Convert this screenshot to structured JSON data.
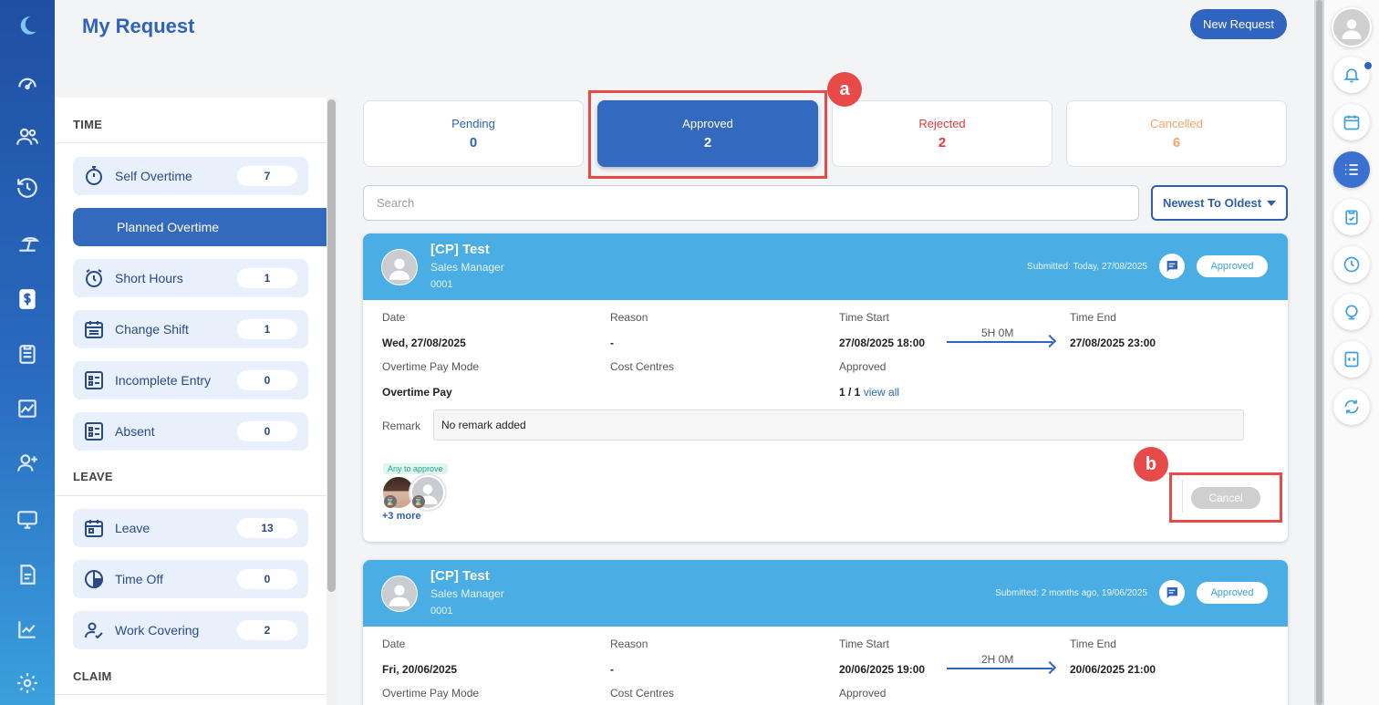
{
  "header": {
    "title": "My Request",
    "new_request_label": "New Request"
  },
  "sections": {
    "time": "TIME",
    "leave": "LEAVE",
    "claim": "CLAIM"
  },
  "categories": [
    {
      "label": "Self Overtime",
      "count": "7",
      "icon": "stopwatch-icon"
    },
    {
      "label": "Planned Overtime",
      "count": "",
      "icon": ""
    },
    {
      "label": "Short Hours",
      "count": "1",
      "icon": "alarm-clock-icon"
    },
    {
      "label": "Change Shift",
      "count": "1",
      "icon": "calendar-list-icon"
    },
    {
      "label": "Incomplete Entry",
      "count": "0",
      "icon": "form-icon"
    },
    {
      "label": "Absent",
      "count": "0",
      "icon": "form-icon"
    },
    {
      "label": "Leave",
      "count": "13",
      "icon": "calendar-icon"
    },
    {
      "label": "Time Off",
      "count": "0",
      "icon": "clock-half-icon"
    },
    {
      "label": "Work Covering",
      "count": "2",
      "icon": "user-check-icon"
    }
  ],
  "status_tabs": [
    {
      "label": "Pending",
      "count": "0",
      "color": "#2e63b8"
    },
    {
      "label": "Approved",
      "count": "2",
      "color": "#ffffff"
    },
    {
      "label": "Rejected",
      "count": "2",
      "color": "#e23b3b"
    },
    {
      "label": "Cancelled",
      "count": "6",
      "color": "#f5a46c"
    }
  ],
  "annotations": {
    "a": "a",
    "b": "b"
  },
  "search": {
    "placeholder": "Search"
  },
  "sort": {
    "label": "Newest To Oldest"
  },
  "labels": {
    "date": "Date",
    "reason": "Reason",
    "time_start": "Time Start",
    "time_end": "Time End",
    "pay_mode": "Overtime Pay Mode",
    "cost_centres": "Cost Centres",
    "approved": "Approved",
    "remark": "Remark",
    "any_to_approve": "Any to approve",
    "view_all": "view all",
    "cancel": "Cancel"
  },
  "requests": [
    {
      "name": "[CP] Test",
      "role": "Sales Manager",
      "id": "0001",
      "submitted": "Submitted: Today, 27/08/2025",
      "status": "Approved",
      "date": "Wed, 27/08/2025",
      "reason": "-",
      "time_start": "27/08/2025 18:00",
      "duration": "5H 0M",
      "time_end": "27/08/2025 23:00",
      "pay_mode": "Overtime Pay",
      "approved_count": "1 / 1",
      "remark": "No remark added",
      "more_approvers": "+3 more"
    },
    {
      "name": "[CP] Test",
      "role": "Sales Manager",
      "id": "0001",
      "submitted": "Submitted: 2 months ago, 19/06/2025",
      "status": "Approved",
      "date": "Fri, 20/06/2025",
      "reason": "-",
      "time_start": "20/06/2025 19:00",
      "duration": "2H 0M",
      "time_end": "20/06/2025 21:00"
    }
  ],
  "colors": {
    "accent": "#2f64c0",
    "card_header": "#4aaee4",
    "highlight": "#e84a4a"
  }
}
